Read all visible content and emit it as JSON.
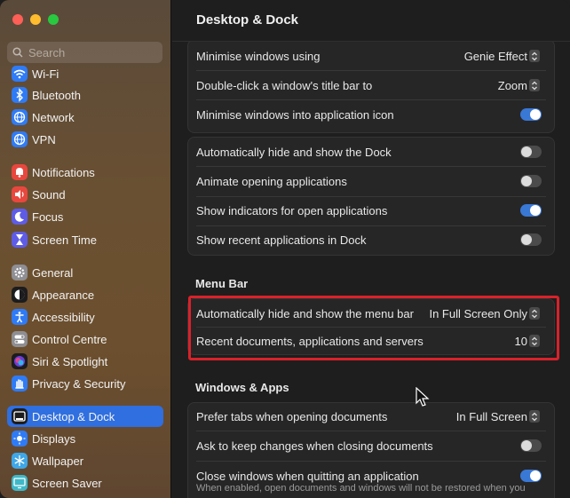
{
  "window": {
    "title": "Desktop & Dock"
  },
  "search": {
    "placeholder": "Search"
  },
  "sidebar": {
    "items": [
      {
        "label": "Wi-Fi",
        "icon": "wifi-icon",
        "color": "#2f7bf6"
      },
      {
        "label": "Bluetooth",
        "icon": "bluetooth-icon",
        "color": "#2f7bf6"
      },
      {
        "label": "Network",
        "icon": "globe-icon",
        "color": "#2f7bf6"
      },
      {
        "label": "VPN",
        "icon": "vpn-globe-icon",
        "color": "#2f7bf6"
      },
      {
        "label": "Notifications",
        "icon": "bell-icon",
        "color": "#e8473e"
      },
      {
        "label": "Sound",
        "icon": "speaker-icon",
        "color": "#e8473e"
      },
      {
        "label": "Focus",
        "icon": "moon-icon",
        "color": "#5e5ce6"
      },
      {
        "label": "Screen Time",
        "icon": "hourglass-icon",
        "color": "#5e5ce6"
      },
      {
        "label": "General",
        "icon": "gear-icon",
        "color": "#8e8e93"
      },
      {
        "label": "Appearance",
        "icon": "appearance-icon",
        "color": "#1c1c1e"
      },
      {
        "label": "Accessibility",
        "icon": "accessibility-icon",
        "color": "#2f7bf6"
      },
      {
        "label": "Control Centre",
        "icon": "toggles-icon",
        "color": "#8e8e93"
      },
      {
        "label": "Siri & Spotlight",
        "icon": "siri-icon",
        "color": "#1c1c1e"
      },
      {
        "label": "Privacy & Security",
        "icon": "hand-icon",
        "color": "#2f7bf6"
      },
      {
        "label": "Desktop & Dock",
        "icon": "dock-icon",
        "color": "#1c1c1e",
        "selected": true
      },
      {
        "label": "Displays",
        "icon": "sun-icon",
        "color": "#2f7bf6"
      },
      {
        "label": "Wallpaper",
        "icon": "snowflake-icon",
        "color": "#3fa7e8"
      },
      {
        "label": "Screen Saver",
        "icon": "screensaver-icon",
        "color": "#3fb8c8"
      }
    ]
  },
  "dock_group_a": {
    "minimise_label": "Minimise windows using",
    "minimise_value": "Genie Effect",
    "double_click_label": "Double-click a window's title bar to",
    "double_click_value": "Zoom",
    "minimise_into_icon_label": "Minimise windows into application icon",
    "minimise_into_icon_on": true
  },
  "dock_group_b": {
    "auto_hide_label": "Automatically hide and show the Dock",
    "auto_hide_on": false,
    "animate_label": "Animate opening applications",
    "animate_on": false,
    "indicators_label": "Show indicators for open applications",
    "indicators_on": true,
    "recent_label": "Show recent applications in Dock",
    "recent_on": false
  },
  "menu_bar": {
    "section_title": "Menu Bar",
    "auto_hide_label": "Automatically hide and show the menu bar",
    "auto_hide_value": "In Full Screen Only",
    "recent_docs_label": "Recent documents, applications and servers",
    "recent_docs_value": "10"
  },
  "windows_apps": {
    "section_title": "Windows & Apps",
    "prefer_tabs_label": "Prefer tabs when opening documents",
    "prefer_tabs_value": "In Full Screen",
    "ask_keep_label": "Ask to keep changes when closing documents",
    "ask_keep_on": false,
    "close_windows_label": "Close windows when quitting an application",
    "close_windows_on": true,
    "close_windows_desc": "When enabled, open documents and windows will not be restored when you"
  },
  "colors": {
    "accent": "#2f6fe0",
    "highlight": "#d8222a"
  }
}
